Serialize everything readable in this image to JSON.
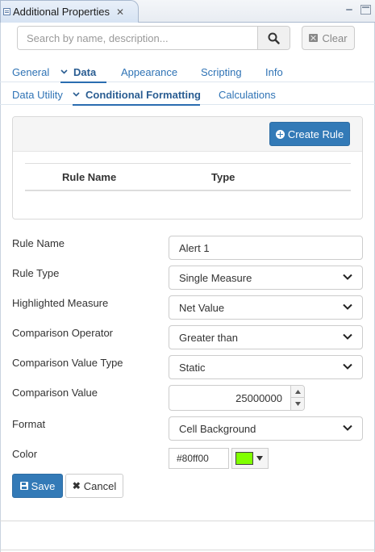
{
  "view": {
    "title": "Additional Properties",
    "close_glyph": "✕"
  },
  "search": {
    "placeholder": "Search by name, description...",
    "clear_label": "Clear"
  },
  "primary_tabs": [
    {
      "label": "General"
    },
    {
      "label": "Data",
      "active": true
    },
    {
      "label": "Appearance"
    },
    {
      "label": "Scripting"
    },
    {
      "label": "Info"
    }
  ],
  "secondary_tabs": [
    {
      "label": "Data Utility"
    },
    {
      "label": "Conditional Formatting",
      "active": true
    },
    {
      "label": "Calculations"
    }
  ],
  "rules": {
    "create_label": "Create Rule",
    "columns": [
      "Rule Name",
      "Type"
    ],
    "rows": []
  },
  "form": {
    "rule_name": {
      "label": "Rule Name",
      "value": "Alert 1"
    },
    "rule_type": {
      "label": "Rule Type",
      "value": "Single Measure"
    },
    "highlighted_measure": {
      "label": "Highlighted Measure",
      "value": "Net Value"
    },
    "comparison_operator": {
      "label": "Comparison Operator",
      "value": "Greater than"
    },
    "comparison_value_type": {
      "label": "Comparison Value Type",
      "value": "Static"
    },
    "comparison_value": {
      "label": "Comparison Value",
      "value": "25000000"
    },
    "format": {
      "label": "Format",
      "value": "Cell Background"
    },
    "color": {
      "label": "Color",
      "value": "#80ff00"
    }
  },
  "actions": {
    "save_label": "Save",
    "cancel_label": "Cancel"
  },
  "colors": {
    "accent": "#337ab7",
    "link": "#2f73b5",
    "swatch": "#80ff00"
  }
}
